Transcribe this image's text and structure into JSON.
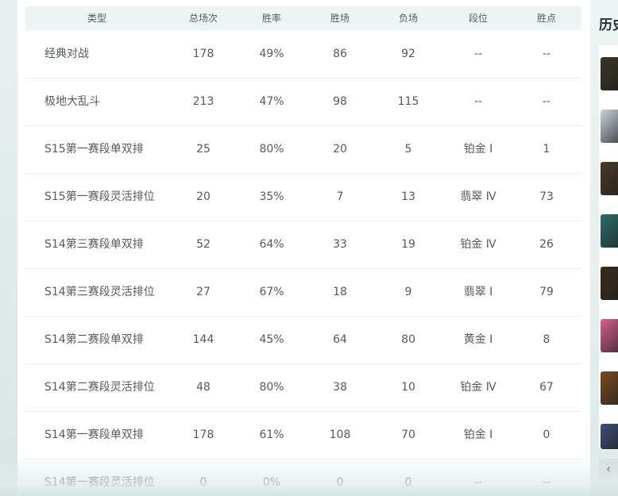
{
  "table": {
    "headers": {
      "type": "类型",
      "total": "总场次",
      "win_rate": "胜率",
      "wins": "胜场",
      "losses": "负场",
      "rank": "段位",
      "lp": "胜点"
    },
    "rows": [
      {
        "type": "经典对战",
        "total": "178",
        "win_rate": "49%",
        "wins": "86",
        "losses": "92",
        "rank": "--",
        "lp": "--"
      },
      {
        "type": "极地大乱斗",
        "total": "213",
        "win_rate": "47%",
        "wins": "98",
        "losses": "115",
        "rank": "--",
        "lp": "--"
      },
      {
        "type": "S15第一赛段单双排",
        "total": "25",
        "win_rate": "80%",
        "wins": "20",
        "losses": "5",
        "rank": "铂金 Ⅰ",
        "lp": "1"
      },
      {
        "type": "S15第一赛段灵活排位",
        "total": "20",
        "win_rate": "35%",
        "wins": "7",
        "losses": "13",
        "rank": "翡翠 Ⅳ",
        "lp": "73"
      },
      {
        "type": "S14第三赛段单双排",
        "total": "52",
        "win_rate": "64%",
        "wins": "33",
        "losses": "19",
        "rank": "铂金 Ⅳ",
        "lp": "26"
      },
      {
        "type": "S14第三赛段灵活排位",
        "total": "27",
        "win_rate": "67%",
        "wins": "18",
        "losses": "9",
        "rank": "翡翠 Ⅰ",
        "lp": "79"
      },
      {
        "type": "S14第二赛段单双排",
        "total": "144",
        "win_rate": "45%",
        "wins": "64",
        "losses": "80",
        "rank": "黄金 Ⅰ",
        "lp": "8"
      },
      {
        "type": "S14第二赛段灵活排位",
        "total": "48",
        "win_rate": "80%",
        "wins": "38",
        "losses": "10",
        "rank": "铂金 Ⅳ",
        "lp": "67"
      },
      {
        "type": "S14第一赛段单双排",
        "total": "178",
        "win_rate": "61%",
        "wins": "108",
        "losses": "70",
        "rank": "铂金 Ⅰ",
        "lp": "0"
      },
      {
        "type": "S14第一赛段灵活排位",
        "total": "0",
        "win_rate": "0%",
        "wins": "0",
        "losses": "0",
        "rank": "--",
        "lp": "--"
      }
    ]
  },
  "side_panel": {
    "title": "历史",
    "scroll_left_icon": "‹",
    "thumbnail_colors": [
      "#3a3526",
      "#c9d3dc",
      "#4a3a22",
      "#2c6f6a",
      "#3b2c1f",
      "#d8608e",
      "#7a4a1f",
      "#3e4f7a"
    ]
  },
  "colors": {
    "header_bg": "#eef4f4",
    "row_divider": "#ebeeee",
    "text": "#555a5a"
  }
}
